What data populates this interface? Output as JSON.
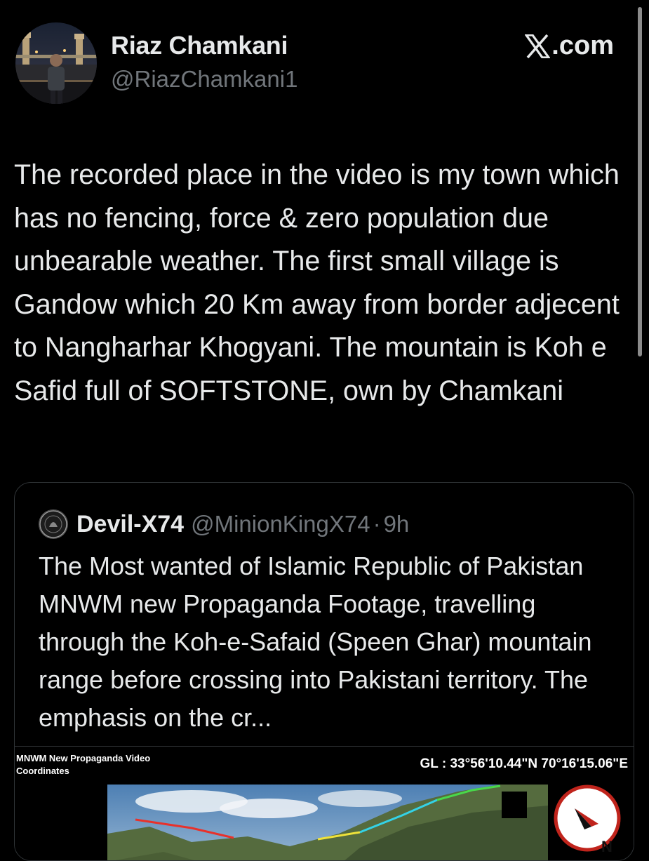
{
  "author": {
    "display_name": "Riaz Chamkani",
    "handle": "@RiazChamkani1",
    "avatar_icon": "profile-photo"
  },
  "brand": {
    "label": ".com",
    "logo_icon": "x-logo-icon"
  },
  "tweet": {
    "text": "The recorded place in the video is my town which has no fencing, force & zero population due unbearable weather. The first small village is Gandow which 20 Km away from border adjecent to Nangharhar Khogyani. The mountain is Koh e Safid full of SOFTSTONE, own by Chamkani"
  },
  "quoted_tweet": {
    "display_name": "Devil-X74",
    "handle": "@MinionKingX74",
    "separator": "·",
    "time": "9h",
    "text": "The Most wanted of Islamic Republic of Pakistan MNWM new Propaganda Footage, travelling through the Koh-e-Safaid (Speen Ghar) mountain range before crossing into Pakistani territory. The emphasis on the cr...",
    "media": {
      "caption_line1": "MNWM New Propaganda Video",
      "caption_line2": "Coordinates",
      "coordinates": "GL : 33°56'10.44\"N 70°16'15.06\"E",
      "compass_label": "N"
    }
  },
  "colors": {
    "background": "#000000",
    "text_primary": "#e7e9ea",
    "text_secondary": "#71767b",
    "border": "#2f3336"
  }
}
